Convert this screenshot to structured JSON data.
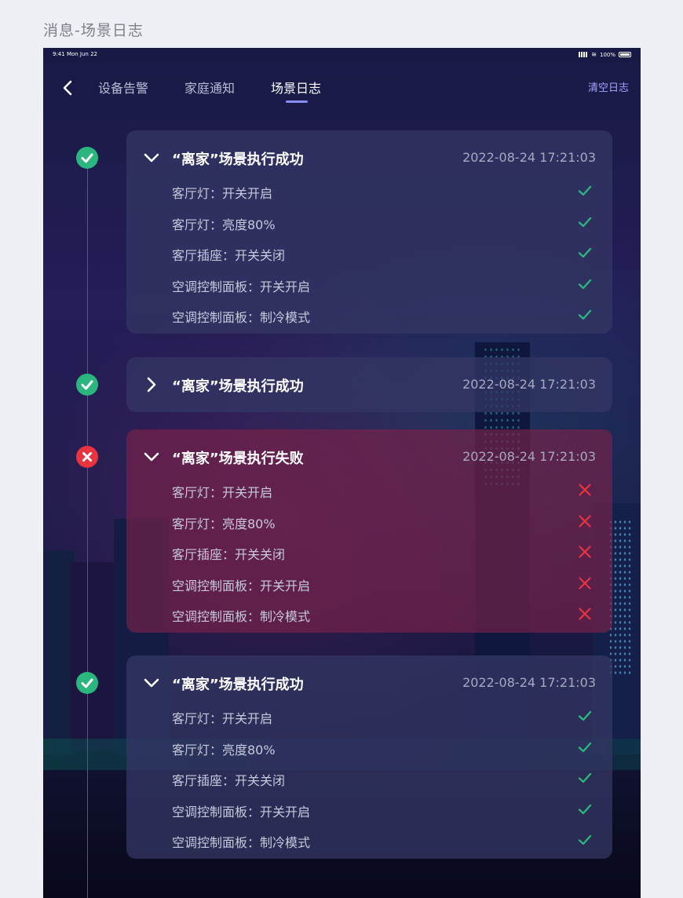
{
  "page": {
    "title": "消息-场景日志"
  },
  "status_bar": {
    "time": "9:41  Mon Jun 22",
    "battery": "100%"
  },
  "nav": {
    "tabs": [
      {
        "label": "设备告警",
        "active": false
      },
      {
        "label": "家庭通知",
        "active": false
      },
      {
        "label": "场景日志",
        "active": true
      }
    ],
    "clear_label": "清空日志",
    "accent_color": "#8b8cf3"
  },
  "colors": {
    "success": "#2bb67f",
    "fail": "#e8343f"
  },
  "logs": [
    {
      "status": "success",
      "expanded": true,
      "title": "“离家”场景执行成功",
      "time": "2022-08-24 17:21:03",
      "items": [
        {
          "label": "客厅灯：开关开启",
          "result": "success"
        },
        {
          "label": "客厅灯：亮度80%",
          "result": "success"
        },
        {
          "label": "客厅插座：开关关闭",
          "result": "success"
        },
        {
          "label": "空调控制面板：开关开启",
          "result": "success"
        },
        {
          "label": "空调控制面板：制冷模式",
          "result": "success"
        }
      ]
    },
    {
      "status": "success",
      "expanded": false,
      "title": "“离家”场景执行成功",
      "time": "2022-08-24 17:21:03",
      "items": []
    },
    {
      "status": "fail",
      "expanded": true,
      "title": "“离家”场景执行失败",
      "time": "2022-08-24 17:21:03",
      "items": [
        {
          "label": "客厅灯：开关开启",
          "result": "fail"
        },
        {
          "label": "客厅灯：亮度80%",
          "result": "fail"
        },
        {
          "label": "客厅插座：开关关闭",
          "result": "fail"
        },
        {
          "label": "空调控制面板：开关开启",
          "result": "fail"
        },
        {
          "label": "空调控制面板：制冷模式",
          "result": "fail"
        }
      ]
    },
    {
      "status": "success",
      "expanded": true,
      "title": "“离家”场景执行成功",
      "time": "2022-08-24 17:21:03",
      "items": [
        {
          "label": "客厅灯：开关开启",
          "result": "success"
        },
        {
          "label": "客厅灯：亮度80%",
          "result": "success"
        },
        {
          "label": "客厅插座：开关关闭",
          "result": "success"
        },
        {
          "label": "空调控制面板：开关开启",
          "result": "success"
        },
        {
          "label": "空调控制面板：制冷模式",
          "result": "success"
        }
      ]
    }
  ]
}
